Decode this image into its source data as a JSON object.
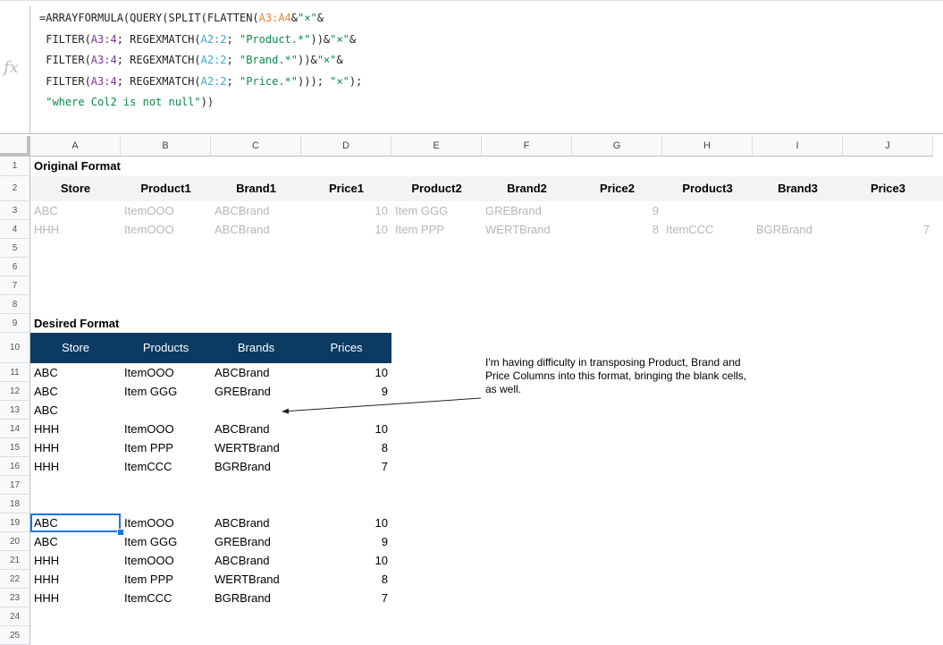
{
  "formula_bar": {
    "fx_icon": "fx-icon",
    "formula_lines": [
      "=ARRAYFORMULA(QUERY(SPLIT(FLATTEN(A3:A4&\"×\"&",
      " FILTER(A3:4; REGEXMATCH(A2:2; \"Product.*\"))&\"×\"&",
      " FILTER(A3:4; REGEXMATCH(A2:2; \"Brand.*\"))&\"×\"&",
      " FILTER(A3:4; REGEXMATCH(A2:2; \"Price.*\"))); \"×\");",
      " \"where Col2 is not null\"))"
    ]
  },
  "columns": [
    "A",
    "B",
    "C",
    "D",
    "E",
    "F",
    "G",
    "H",
    "I",
    "J"
  ],
  "rows": [
    {
      "num": "1",
      "style": "title",
      "cells": [
        "Original Format"
      ]
    },
    {
      "num": "2",
      "style": "header",
      "cells": [
        "Store",
        "Product1",
        "Brand1",
        "Price1",
        "Product2",
        "Brand2",
        "Price2",
        "Product3",
        "Brand3",
        "Price3"
      ]
    },
    {
      "num": "3",
      "style": "muted",
      "cells": [
        "ABC",
        "ItemOOO",
        "ABCBrand",
        "10",
        "Item GGG",
        "GREBrand",
        "9",
        "",
        "",
        ""
      ]
    },
    {
      "num": "4",
      "style": "muted",
      "cells": [
        "HHH",
        "ItemOOO",
        "ABCBrand",
        "10",
        "Item PPP",
        "WERTBrand",
        "8",
        "ItemCCC",
        "BGRBrand",
        "7"
      ]
    },
    {
      "num": "5",
      "cells": []
    },
    {
      "num": "6",
      "cells": []
    },
    {
      "num": "7",
      "cells": []
    },
    {
      "num": "8",
      "cells": []
    },
    {
      "num": "9",
      "style": "title",
      "cells": [
        "Desired Format"
      ]
    },
    {
      "num": "10",
      "style": "dark",
      "cells": [
        "Store",
        "Products",
        "Brands",
        "Prices"
      ]
    },
    {
      "num": "11",
      "cells": [
        "ABC",
        "ItemOOO",
        "ABCBrand",
        "10"
      ]
    },
    {
      "num": "12",
      "cells": [
        "ABC",
        "Item GGG",
        "GREBrand",
        "9"
      ]
    },
    {
      "num": "13",
      "cells": [
        "ABC",
        "",
        "",
        ""
      ]
    },
    {
      "num": "14",
      "cells": [
        "HHH",
        "ItemOOO",
        "ABCBrand",
        "10"
      ]
    },
    {
      "num": "15",
      "cells": [
        "HHH",
        "Item PPP",
        "WERTBrand",
        "8"
      ]
    },
    {
      "num": "16",
      "cells": [
        "HHH",
        "ItemCCC",
        "BGRBrand",
        "7"
      ]
    },
    {
      "num": "17",
      "cells": []
    },
    {
      "num": "18",
      "cells": []
    },
    {
      "num": "19",
      "cells": [
        "ABC",
        "ItemOOO",
        "ABCBrand",
        "10"
      ]
    },
    {
      "num": "20",
      "cells": [
        "ABC",
        "Item GGG",
        "GREBrand",
        "9"
      ]
    },
    {
      "num": "21",
      "cells": [
        "HHH",
        "ItemOOO",
        "ABCBrand",
        "10"
      ]
    },
    {
      "num": "22",
      "cells": [
        "HHH",
        "Item PPP",
        "WERTBrand",
        "8"
      ]
    },
    {
      "num": "23",
      "cells": [
        "HHH",
        "ItemCCC",
        "BGRBrand",
        "7"
      ]
    },
    {
      "num": "24",
      "cells": []
    },
    {
      "num": "25",
      "cells": []
    }
  ],
  "selected_cell": "A19",
  "annotation": {
    "text": "I'm having difficulty in transposing Product, Brand and Price Columns into this format, bringing the blank cells, as well."
  },
  "colors": {
    "dark_header": "#0b3a63",
    "selection": "#1a73e8",
    "muted_text": "#b7b7b7"
  }
}
